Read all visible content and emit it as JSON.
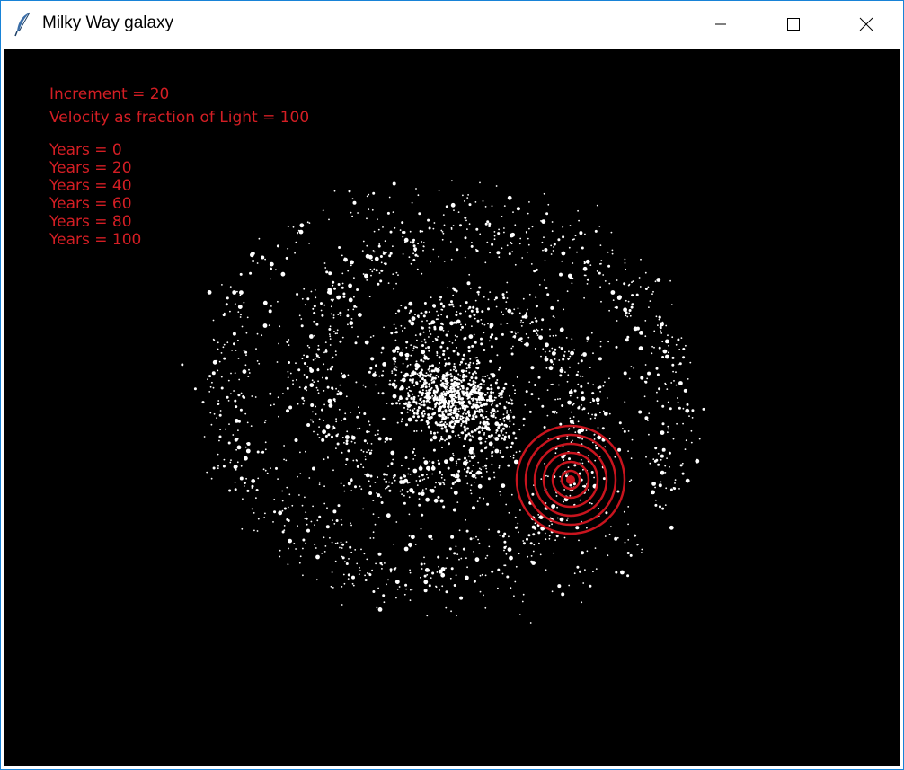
{
  "window": {
    "title": "Milky Way galaxy",
    "app_icon": "feather-icon",
    "controls": [
      "minimize-icon",
      "maximize-icon",
      "close-icon"
    ]
  },
  "canvas": {
    "background": "#000000",
    "text_color": "#d41e24",
    "star_color": "#ffffff",
    "increment_text": "Increment = 20",
    "velocity_text": "Velocity as fraction of Light = 100",
    "years": [
      "Years = 0",
      "Years = 20",
      "Years = 40",
      "Years = 60",
      "Years = 80",
      "Years = 100"
    ],
    "signal_rings": 6,
    "ring_color": "#c8141e"
  }
}
